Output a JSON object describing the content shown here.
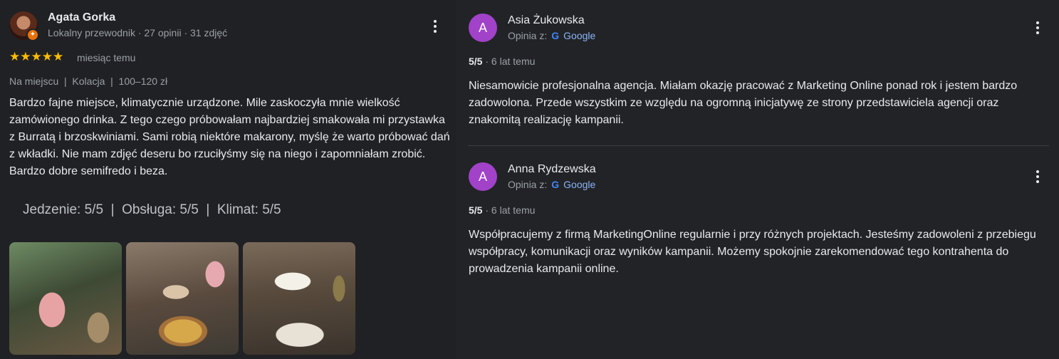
{
  "left_review": {
    "author": "Agata Gorka",
    "author_meta": "Lokalny przewodnik · 27 opinii · 31 zdjęć",
    "stars": "★★★★★",
    "time": "miesiąc temu",
    "tags": "Na miejscu  |  Kolacja  |  100–120 zł",
    "text": "Bardzo fajne miejsce, klimatycznie urządzone. Mile zaskoczyła mnie wielkość zamówionego drinka. Z tego czego próbowałam najbardziej smakowała mi przystawka z Burratą i brzoskwiniami. Sami robią niektóre makarony, myślę że warto próbować dań z wkładki. Nie mam zdjęć deseru bo rzuciłyśmy się na niego i zapomniałam zrobić. Bardzo dobre semifredo i beza.",
    "ratings": "Jedzenie: 5/5  |  Obsługa: 5/5  |  Klimat: 5/5"
  },
  "right_reviews": [
    {
      "initial": "A",
      "author": "Asia Żukowska",
      "source_label": "Opinia z:",
      "source_name": "Google",
      "score": "5/5",
      "time": " · 6 lat temu",
      "text": "Niesamowicie profesjonalna agencja. Miałam okazję pracować z Marketing Online ponad rok i jestem bardzo zadowolona. Przede wszystkim ze względu na ogromną inicjatywę ze strony przedstawiciela agencji oraz znakomitą realizację kampanii."
    },
    {
      "initial": "A",
      "author": "Anna Rydzewska",
      "source_label": "Opinia z:",
      "source_name": "Google",
      "score": "5/5",
      "time": " · 6 lat temu",
      "text": "Współpracujemy z firmą MarketingOnline regularnie i przy różnych projektach. Jesteśmy zadowoleni z przebiegu współpracy, komunikacji oraz wyników kampanii. Możemy spokojnie zarekomendować tego kontrahenta do prowadzenia kampanii online."
    }
  ],
  "colors": {
    "accent_avatar": "#a142c9",
    "star": "#fbbc04",
    "link": "#8ab4f8",
    "guide_badge": "#e8710a"
  },
  "icons": {
    "menu": "more-vert-icon",
    "google": "google-g-icon",
    "guide": "local-guide-badge-icon"
  }
}
